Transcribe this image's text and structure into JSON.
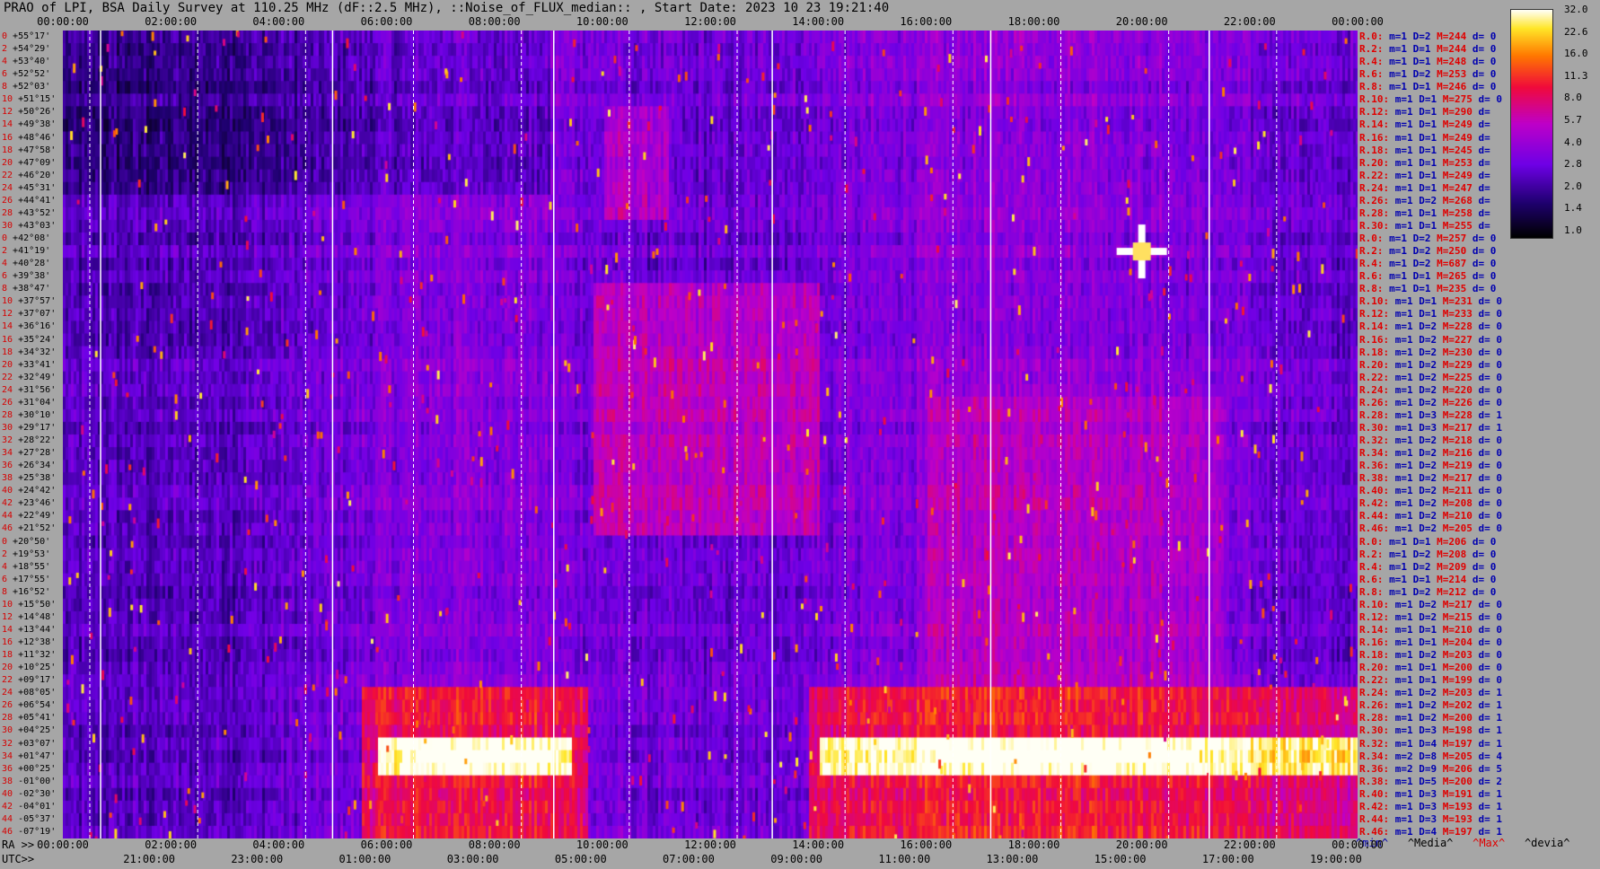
{
  "title": "PRAO of LPI, BSA Daily Survey at 110.25 MHz (dF::2.5 MHz), ::Noise_of_FLUX_median:: , Start Date: 2023 10 23 19:21:40",
  "top_axis": [
    "00:00:00",
    "02:00:00",
    "04:00:00",
    "06:00:00",
    "08:00:00",
    "10:00:00",
    "12:00:00",
    "14:00:00",
    "16:00:00",
    "18:00:00",
    "20:00:00",
    "22:00:00",
    "00:00:00"
  ],
  "ra_prefix": "RA >>",
  "ra_axis": [
    "00:00:00",
    "02:00:00",
    "04:00:00",
    "06:00:00",
    "08:00:00",
    "10:00:00",
    "12:00:00",
    "14:00:00",
    "16:00:00",
    "18:00:00",
    "20:00:00",
    "22:00:00",
    "00:00:00"
  ],
  "utc_prefix": "UTC>>",
  "utc_axis": [
    "21:00:00",
    "23:00:00",
    "01:00:00",
    "03:00:00",
    "05:00:00",
    "07:00:00",
    "09:00:00",
    "11:00:00",
    "13:00:00",
    "15:00:00",
    "17:00:00",
    "19:00:00"
  ],
  "colorbar_ticks": [
    "32.0",
    "22.6",
    "16.0",
    "11.3",
    "8.0",
    "5.7",
    "4.0",
    "2.8",
    "2.0",
    "1.4",
    "1.0"
  ],
  "colors": {
    "background": "#a6a6a6",
    "stat_label": "#e00000",
    "stat_key": "#0000b0"
  },
  "footer": {
    "min": "^min^",
    "median": "^Media^",
    "max": "^Max^",
    "devia": "^devia^"
  },
  "chart_data": {
    "type": "heatmap",
    "title": "PRAO of LPI, BSA Daily Survey at 110.25 MHz (dF::2.5 MHz), ::Noise_of_FLUX_median:: , Start Date: 2023 10 23 19:21:40",
    "colormap": "black-blue-purple-red-orange-yellow-white",
    "zlim": [
      1.0,
      32.0
    ],
    "x_axis": "RA / UTC, 00:00:00 to 24:00:00 sidereal",
    "rows": [
      {
        "idx": "0",
        "dec": "+55°17'",
        "R": "R.0:",
        "m": "1",
        "D": "2",
        "M": "244",
        "d": "0"
      },
      {
        "idx": "2",
        "dec": "+54°29'",
        "R": "R.2:",
        "m": "1",
        "D": "1",
        "M": "244",
        "d": "0"
      },
      {
        "idx": "4",
        "dec": "+53°40'",
        "R": "R.4:",
        "m": "1",
        "D": "1",
        "M": "248",
        "d": "0"
      },
      {
        "idx": "6",
        "dec": "+52°52'",
        "R": "R.6:",
        "m": "1",
        "D": "2",
        "M": "253",
        "d": "0"
      },
      {
        "idx": "8",
        "dec": "+52°03'",
        "R": "R.8:",
        "m": "1",
        "D": "1",
        "M": "246",
        "d": "0"
      },
      {
        "idx": "10",
        "dec": "+51°15'",
        "R": "R.10:",
        "m": "1",
        "D": "1",
        "M": "275",
        "d": "0"
      },
      {
        "idx": "12",
        "dec": "+50°26'",
        "R": "R.12:",
        "m": "1",
        "D": "1",
        "M": "290",
        "d": ""
      },
      {
        "idx": "14",
        "dec": "+49°38'",
        "R": "R.14:",
        "m": "1",
        "D": "1",
        "M": "249",
        "d": ""
      },
      {
        "idx": "16",
        "dec": "+48°46'",
        "R": "R.16:",
        "m": "1",
        "D": "1",
        "M": "249",
        "d": ""
      },
      {
        "idx": "18",
        "dec": "+47°58'",
        "R": "R.18:",
        "m": "1",
        "D": "1",
        "M": "245",
        "d": ""
      },
      {
        "idx": "20",
        "dec": "+47°09'",
        "R": "R.20:",
        "m": "1",
        "D": "1",
        "M": "253",
        "d": ""
      },
      {
        "idx": "22",
        "dec": "+46°20'",
        "R": "R.22:",
        "m": "1",
        "D": "1",
        "M": "249",
        "d": ""
      },
      {
        "idx": "24",
        "dec": "+45°31'",
        "R": "R.24:",
        "m": "1",
        "D": "1",
        "M": "247",
        "d": ""
      },
      {
        "idx": "26",
        "dec": "+44°41'",
        "R": "R.26:",
        "m": "1",
        "D": "2",
        "M": "268",
        "d": ""
      },
      {
        "idx": "28",
        "dec": "+43°52'",
        "R": "R.28:",
        "m": "1",
        "D": "1",
        "M": "258",
        "d": ""
      },
      {
        "idx": "30",
        "dec": "+43°03'",
        "R": "R.30:",
        "m": "1",
        "D": "1",
        "M": "255",
        "d": ""
      },
      {
        "idx": "0",
        "dec": "+42°08'",
        "R": "R.0:",
        "m": "1",
        "D": "2",
        "M": "257",
        "d": "0"
      },
      {
        "idx": "2",
        "dec": "+41°19'",
        "R": "R.2:",
        "m": "1",
        "D": "2",
        "M": "250",
        "d": "0"
      },
      {
        "idx": "4",
        "dec": "+40°28'",
        "R": "R.4:",
        "m": "1",
        "D": "2",
        "M": "687",
        "d": "0"
      },
      {
        "idx": "6",
        "dec": "+39°38'",
        "R": "R.6:",
        "m": "1",
        "D": "1",
        "M": "265",
        "d": "0"
      },
      {
        "idx": "8",
        "dec": "+38°47'",
        "R": "R.8:",
        "m": "1",
        "D": "1",
        "M": "235",
        "d": "0"
      },
      {
        "idx": "10",
        "dec": "+37°57'",
        "R": "R.10:",
        "m": "1",
        "D": "1",
        "M": "231",
        "d": "0"
      },
      {
        "idx": "12",
        "dec": "+37°07'",
        "R": "R.12:",
        "m": "1",
        "D": "1",
        "M": "233",
        "d": "0"
      },
      {
        "idx": "14",
        "dec": "+36°16'",
        "R": "R.14:",
        "m": "1",
        "D": "2",
        "M": "228",
        "d": "0"
      },
      {
        "idx": "16",
        "dec": "+35°24'",
        "R": "R.16:",
        "m": "1",
        "D": "2",
        "M": "227",
        "d": "0"
      },
      {
        "idx": "18",
        "dec": "+34°32'",
        "R": "R.18:",
        "m": "1",
        "D": "2",
        "M": "230",
        "d": "0"
      },
      {
        "idx": "20",
        "dec": "+33°41'",
        "R": "R.20:",
        "m": "1",
        "D": "2",
        "M": "229",
        "d": "0"
      },
      {
        "idx": "22",
        "dec": "+32°49'",
        "R": "R.22:",
        "m": "1",
        "D": "2",
        "M": "225",
        "d": "0"
      },
      {
        "idx": "24",
        "dec": "+31°56'",
        "R": "R.24:",
        "m": "1",
        "D": "2",
        "M": "220",
        "d": "0"
      },
      {
        "idx": "26",
        "dec": "+31°04'",
        "R": "R.26:",
        "m": "1",
        "D": "2",
        "M": "226",
        "d": "0"
      },
      {
        "idx": "28",
        "dec": "+30°10'",
        "R": "R.28:",
        "m": "1",
        "D": "3",
        "M": "228",
        "d": "1"
      },
      {
        "idx": "30",
        "dec": "+29°17'",
        "R": "R.30:",
        "m": "1",
        "D": "3",
        "M": "217",
        "d": "1"
      },
      {
        "idx": "32",
        "dec": "+28°22'",
        "R": "R.32:",
        "m": "1",
        "D": "2",
        "M": "218",
        "d": "0"
      },
      {
        "idx": "34",
        "dec": "+27°28'",
        "R": "R.34:",
        "m": "1",
        "D": "2",
        "M": "216",
        "d": "0"
      },
      {
        "idx": "36",
        "dec": "+26°34'",
        "R": "R.36:",
        "m": "1",
        "D": "2",
        "M": "219",
        "d": "0"
      },
      {
        "idx": "38",
        "dec": "+25°38'",
        "R": "R.38:",
        "m": "1",
        "D": "2",
        "M": "217",
        "d": "0"
      },
      {
        "idx": "40",
        "dec": "+24°42'",
        "R": "R.40:",
        "m": "1",
        "D": "2",
        "M": "211",
        "d": "0"
      },
      {
        "idx": "42",
        "dec": "+23°46'",
        "R": "R.42:",
        "m": "1",
        "D": "2",
        "M": "208",
        "d": "0"
      },
      {
        "idx": "44",
        "dec": "+22°49'",
        "R": "R.44:",
        "m": "1",
        "D": "2",
        "M": "210",
        "d": "0"
      },
      {
        "idx": "46",
        "dec": "+21°52'",
        "R": "R.46:",
        "m": "1",
        "D": "2",
        "M": "205",
        "d": "0"
      },
      {
        "idx": "0",
        "dec": "+20°50'",
        "R": "R.0:",
        "m": "1",
        "D": "1",
        "M": "206",
        "d": "0"
      },
      {
        "idx": "2",
        "dec": "+19°53'",
        "R": "R.2:",
        "m": "1",
        "D": "2",
        "M": "208",
        "d": "0"
      },
      {
        "idx": "4",
        "dec": "+18°55'",
        "R": "R.4:",
        "m": "1",
        "D": "2",
        "M": "209",
        "d": "0"
      },
      {
        "idx": "6",
        "dec": "+17°55'",
        "R": "R.6:",
        "m": "1",
        "D": "1",
        "M": "214",
        "d": "0"
      },
      {
        "idx": "8",
        "dec": "+16°52'",
        "R": "R.8:",
        "m": "1",
        "D": "2",
        "M": "212",
        "d": "0"
      },
      {
        "idx": "10",
        "dec": "+15°50'",
        "R": "R.10:",
        "m": "1",
        "D": "2",
        "M": "217",
        "d": "0"
      },
      {
        "idx": "12",
        "dec": "+14°48'",
        "R": "R.12:",
        "m": "1",
        "D": "2",
        "M": "215",
        "d": "0"
      },
      {
        "idx": "14",
        "dec": "+13°44'",
        "R": "R.14:",
        "m": "1",
        "D": "1",
        "M": "210",
        "d": "0"
      },
      {
        "idx": "16",
        "dec": "+12°38'",
        "R": "R.16:",
        "m": "1",
        "D": "1",
        "M": "204",
        "d": "0"
      },
      {
        "idx": "18",
        "dec": "+11°32'",
        "R": "R.18:",
        "m": "1",
        "D": "2",
        "M": "203",
        "d": "0"
      },
      {
        "idx": "20",
        "dec": "+10°25'",
        "R": "R.20:",
        "m": "1",
        "D": "1",
        "M": "200",
        "d": "0"
      },
      {
        "idx": "22",
        "dec": "+09°17'",
        "R": "R.22:",
        "m": "1",
        "D": "1",
        "M": "199",
        "d": "0"
      },
      {
        "idx": "24",
        "dec": "+08°05'",
        "R": "R.24:",
        "m": "1",
        "D": "2",
        "M": "203",
        "d": "1"
      },
      {
        "idx": "26",
        "dec": "+06°54'",
        "R": "R.26:",
        "m": "1",
        "D": "2",
        "M": "202",
        "d": "1"
      },
      {
        "idx": "28",
        "dec": "+05°41'",
        "R": "R.28:",
        "m": "1",
        "D": "2",
        "M": "200",
        "d": "1"
      },
      {
        "idx": "30",
        "dec": "+04°25'",
        "R": "R.30:",
        "m": "1",
        "D": "3",
        "M": "198",
        "d": "1"
      },
      {
        "idx": "32",
        "dec": "+03°07'",
        "R": "R.32:",
        "m": "1",
        "D": "4",
        "M": "197",
        "d": "1"
      },
      {
        "idx": "34",
        "dec": "+01°47'",
        "R": "R.34:",
        "m": "2",
        "D": "8",
        "M": "205",
        "d": "4"
      },
      {
        "idx": "36",
        "dec": "+00°25'",
        "R": "R.36:",
        "m": "2",
        "D": "9",
        "M": "206",
        "d": "5"
      },
      {
        "idx": "38",
        "dec": "-01°00'",
        "R": "R.38:",
        "m": "1",
        "D": "5",
        "M": "200",
        "d": "2"
      },
      {
        "idx": "40",
        "dec": "-02°30'",
        "R": "R.40:",
        "m": "1",
        "D": "3",
        "M": "191",
        "d": "1"
      },
      {
        "idx": "42",
        "dec": "-04°01'",
        "R": "R.42:",
        "m": "1",
        "D": "3",
        "M": "193",
        "d": "1"
      },
      {
        "idx": "44",
        "dec": "-05°37'",
        "R": "R.44:",
        "m": "1",
        "D": "3",
        "M": "193",
        "d": "1"
      },
      {
        "idx": "46",
        "dec": "-07°19'",
        "R": "R.46:",
        "m": "1",
        "D": "4",
        "M": "197",
        "d": "1"
      }
    ],
    "features": [
      {
        "name": "bright-band",
        "rows": [
          "+01°47'",
          "+00°25'"
        ],
        "ra_ranges": [
          [
            "05:40",
            "09:30"
          ],
          [
            "14:00",
            "24:00"
          ]
        ],
        "level": "white-yellow"
      },
      {
        "name": "warm-band",
        "rows": [
          "+08°05'",
          "-07°19'"
        ],
        "ra_ranges": [
          [
            "05:30",
            "10:00"
          ],
          [
            "16:00",
            "24:00"
          ]
        ],
        "level": "orange-red"
      },
      {
        "name": "point-source",
        "ra": "20:00",
        "dec": "+41°19'",
        "level": "white"
      }
    ]
  }
}
